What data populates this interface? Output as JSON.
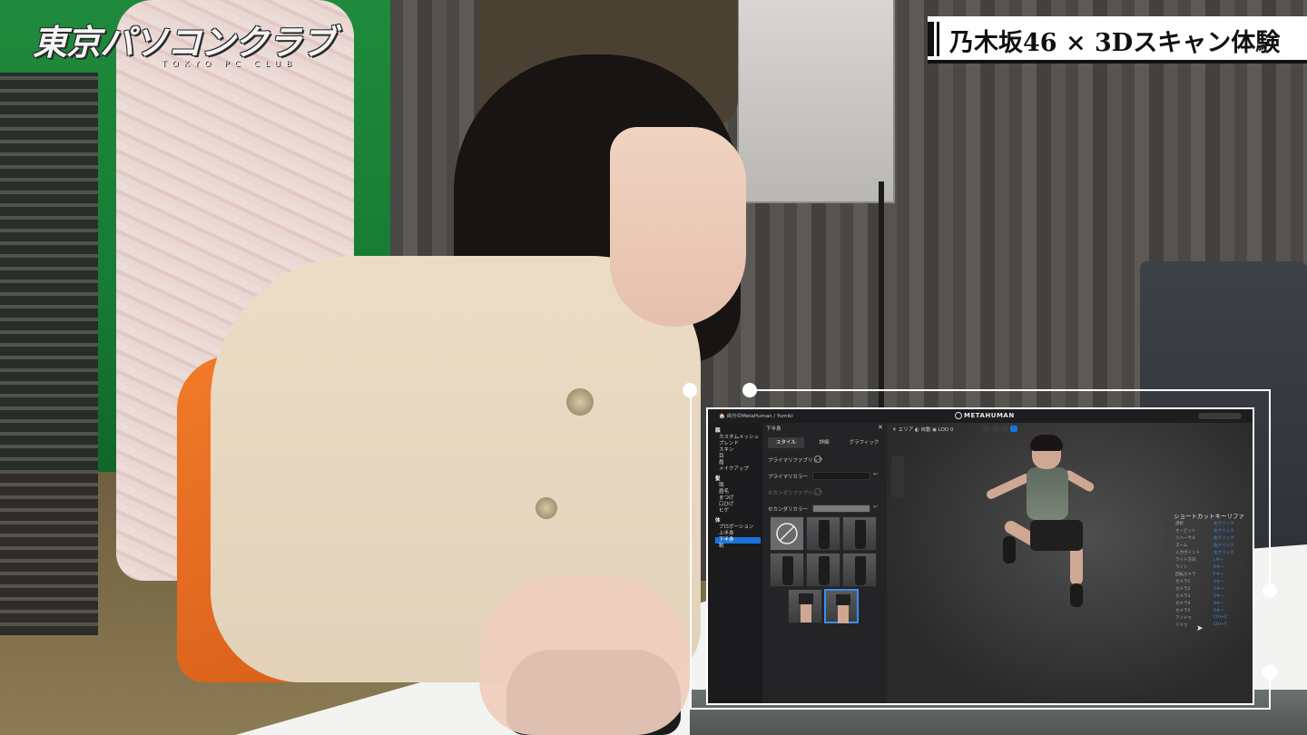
{
  "logo": {
    "title": "東京パソコンクラブ",
    "subtitle": "TOKYO PC CLUB"
  },
  "banner": {
    "title": "乃木坂46 × 3Dスキャン体験"
  },
  "app": {
    "path": "🏠 自分のMetaHuman / Yumiki",
    "brand": "METAHUMAN",
    "sidebar": [
      {
        "label": "顔",
        "type": "head"
      },
      {
        "label": "カスタムメッシュ"
      },
      {
        "label": "ブレンド"
      },
      {
        "label": "スキン"
      },
      {
        "label": "目"
      },
      {
        "label": "眉"
      },
      {
        "label": "メイクアップ"
      },
      {
        "label": "髪",
        "type": "head"
      },
      {
        "label": "頭"
      },
      {
        "label": "眉毛"
      },
      {
        "label": "まつげ"
      },
      {
        "label": "口ひげ"
      },
      {
        "label": "ヒゲ"
      },
      {
        "label": "体",
        "type": "head"
      },
      {
        "label": "プロポーション"
      },
      {
        "label": "上半身"
      },
      {
        "label": "下半身",
        "type": "active"
      },
      {
        "label": "靴"
      }
    ],
    "panel": {
      "title": "下半身",
      "close": "✕",
      "tabs": [
        "スタイル",
        "詳細",
        "グラフィック"
      ],
      "active_tab": 0,
      "primary_fabric_label": "プライマリファブリック",
      "primary_color_label": "プライマリカラー",
      "secondary_fabric_label": "セカンダリファブリック",
      "secondary_color_label": "セカンダリカラー",
      "reset_icon": "↩",
      "selected_tile": 7
    },
    "viewport": {
      "toolbar": "☀ エリア  ◐ 自動  ◉ LOD 0",
      "shortcut_title": "ショートカットキーリファ",
      "shortcut_rows": [
        {
          "key": "選択",
          "value": "左クリック"
        },
        {
          "key": "オービット",
          "value": "左クリック"
        },
        {
          "key": "リハーサル",
          "value": "右クリック"
        },
        {
          "key": "ズーム",
          "value": "右クリック"
        },
        {
          "key": "入力ポイント",
          "value": "左クリック"
        },
        {
          "key": "ライト方向",
          "value": "Lキー"
        },
        {
          "key": "ライト",
          "value": "Rキー"
        },
        {
          "key": "回転カメラ",
          "value": "Fキー"
        },
        {
          "key": "カメラ1",
          "value": "1キー"
        },
        {
          "key": "カメラ2",
          "value": "2キー"
        },
        {
          "key": "カメラ3",
          "value": "3キー"
        },
        {
          "key": "カメラ4",
          "value": "4キー"
        },
        {
          "key": "カメラ5",
          "value": "5キー"
        },
        {
          "key": "アンドゥ",
          "value": "Ctrl+Z"
        },
        {
          "key": "リドゥ",
          "value": "Ctrl+Y"
        }
      ]
    }
  },
  "colors": {
    "accent": "#1a73d9",
    "panel": "#242426",
    "banner_bg": "#ffffff",
    "frame": "#ffffff"
  }
}
